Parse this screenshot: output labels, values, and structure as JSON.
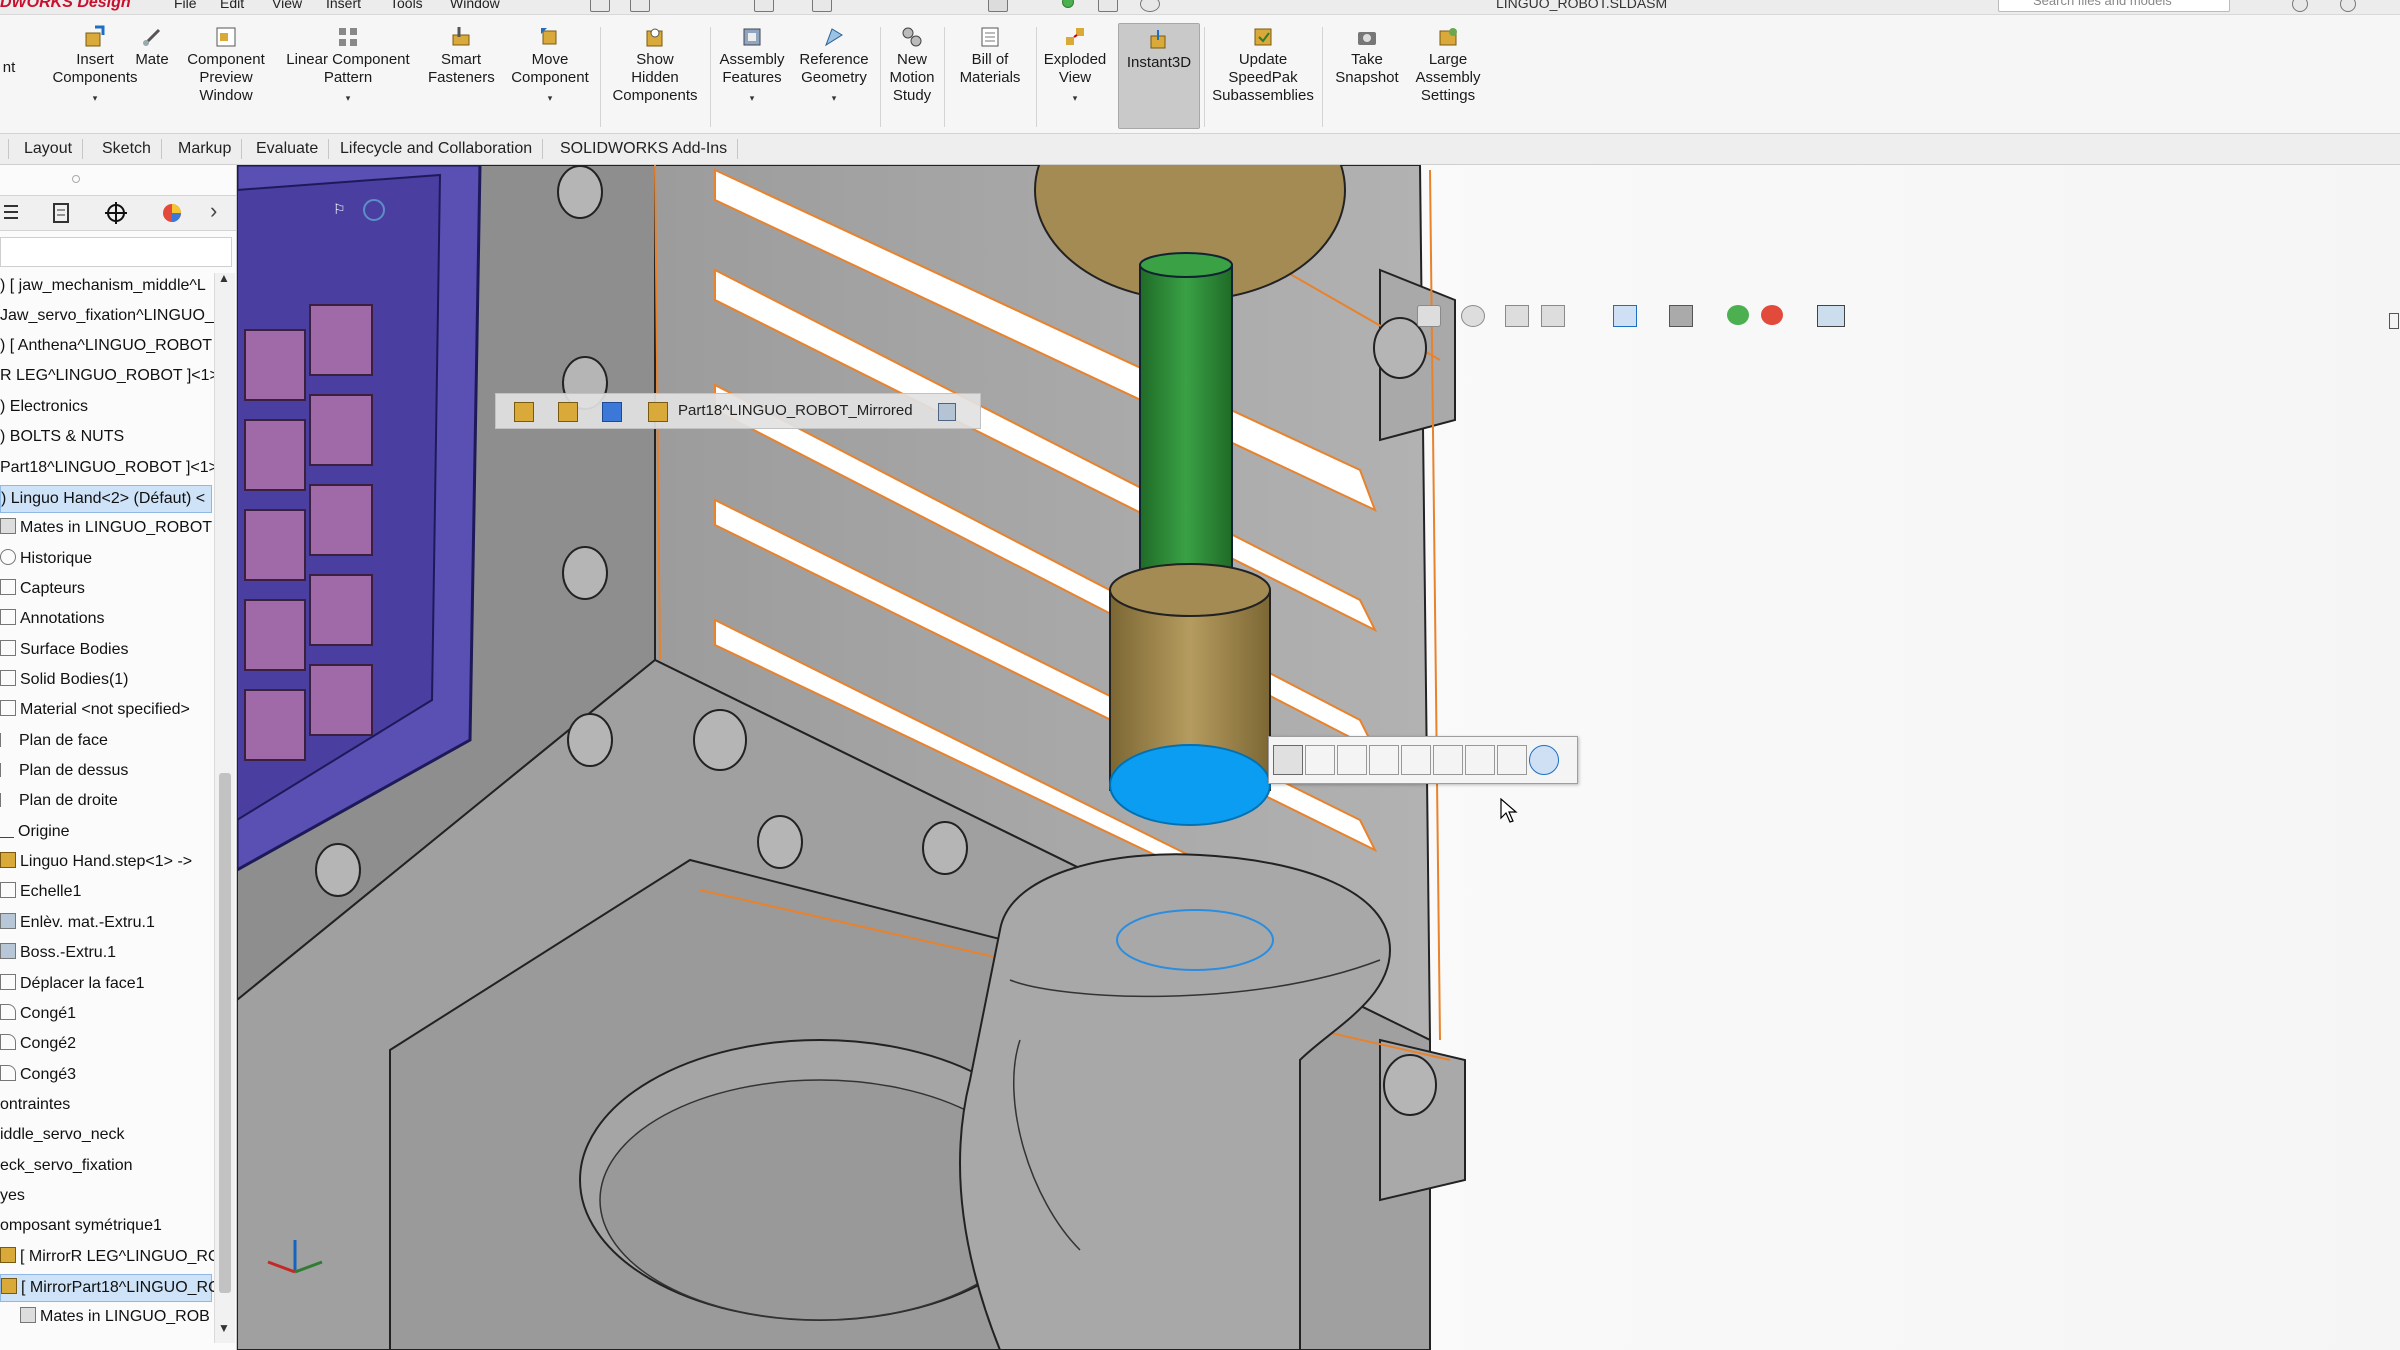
{
  "app": {
    "brand": "DWORKS Design",
    "document_title": "LINGUO_ROBOT.SLDASM",
    "menu": [
      "File",
      "Edit",
      "View",
      "Insert",
      "Tools",
      "Window"
    ],
    "search_placeholder": "Search files and models"
  },
  "ribbon": {
    "buttons": [
      {
        "id": "partial-left",
        "label": "nt"
      },
      {
        "id": "insert-components",
        "label": "Insert\nComponents"
      },
      {
        "id": "mate",
        "label": "Mate"
      },
      {
        "id": "component-preview",
        "label": "Component\nPreview\nWindow"
      },
      {
        "id": "linear-pattern",
        "label": "Linear Component\nPattern"
      },
      {
        "id": "smart-fasteners",
        "label": "Smart\nFasteners"
      },
      {
        "id": "move-component",
        "label": "Move\nComponent"
      },
      {
        "id": "show-hidden",
        "label": "Show\nHidden\nComponents"
      },
      {
        "id": "assembly-features",
        "label": "Assembly\nFeatures"
      },
      {
        "id": "reference-geometry",
        "label": "Reference\nGeometry"
      },
      {
        "id": "new-motion-study",
        "label": "New\nMotion\nStudy"
      },
      {
        "id": "bill-of-materials",
        "label": "Bill of\nMaterials"
      },
      {
        "id": "exploded-view",
        "label": "Exploded\nView"
      },
      {
        "id": "instant3d",
        "label": "Instant3D"
      },
      {
        "id": "update-speedpak",
        "label": "Update\nSpeedPak\nSubassemblies"
      },
      {
        "id": "take-snapshot",
        "label": "Take\nSnapshot"
      },
      {
        "id": "large-assembly",
        "label": "Large\nAssembly\nSettings"
      }
    ]
  },
  "tabs": [
    "Layout",
    "Sketch",
    "Markup",
    "Evaluate",
    "Lifecycle and Collaboration",
    "SOLIDWORKS Add-Ins"
  ],
  "breadcrumb": {
    "label": "Part18^LINGUO_ROBOT_Mirrored"
  },
  "tree": {
    "items": [
      {
        "label": ") [ jaw_mechanism_middle^L"
      },
      {
        "label": "Jaw_servo_fixation^LINGUO_"
      },
      {
        "label": ") [ Anthena^LINGUO_ROBOT"
      },
      {
        "label": "R LEG^LINGUO_ROBOT ]<1>"
      },
      {
        "label": ") Electronics"
      },
      {
        "label": ") BOLTS & NUTS"
      },
      {
        "label": "Part18^LINGUO_ROBOT ]<1>"
      },
      {
        "label": ") Linguo Hand<2> (Défaut) <"
      },
      {
        "label": "Mates in LINGUO_ROBOT"
      },
      {
        "label": "Historique"
      },
      {
        "label": "Capteurs"
      },
      {
        "label": "Annotations"
      },
      {
        "label": "Surface Bodies"
      },
      {
        "label": "Solid Bodies(1)"
      },
      {
        "label": "Material <not specified>"
      },
      {
        "label": "Plan de face"
      },
      {
        "label": "Plan de dessus"
      },
      {
        "label": "Plan de droite"
      },
      {
        "label": "Origine"
      },
      {
        "label": "Linguo Hand.step<1> ->"
      },
      {
        "label": "Echelle1"
      },
      {
        "label": "Enlèv. mat.-Extru.1"
      },
      {
        "label": "Boss.-Extru.1"
      },
      {
        "label": "Déplacer la face1"
      },
      {
        "label": "Congé1"
      },
      {
        "label": "Congé2"
      },
      {
        "label": "Congé3"
      },
      {
        "label": "ontraintes"
      },
      {
        "label": "iddle_servo_neck"
      },
      {
        "label": "eck_servo_fixation"
      },
      {
        "label": "yes"
      },
      {
        "label": "omposant symétrique1"
      },
      {
        "label": "[ MirrorR LEG^LINGUO_RO"
      },
      {
        "label": "[ MirrorPart18^LINGUO_RO"
      },
      {
        "label": "Mates in LINGUO_ROB"
      }
    ],
    "selected_index": 7,
    "highlighted_index": 33
  },
  "context_toolbar": {
    "tools": [
      "pierce-icon",
      "parallel-icon",
      "perpendicular-icon",
      "lock-icon",
      "distance-icon",
      "dimension-icon",
      "angle-icon",
      "tangent-icon",
      "concentric-icon"
    ]
  },
  "colors": {
    "selection_blue": "#0a9df2",
    "edge_orange": "#e8822c",
    "model_gray": "#a7a7a7",
    "rod_green": "#2f8a35",
    "bronze": "#a48b53",
    "keypad_purple": "#a06aa8"
  }
}
